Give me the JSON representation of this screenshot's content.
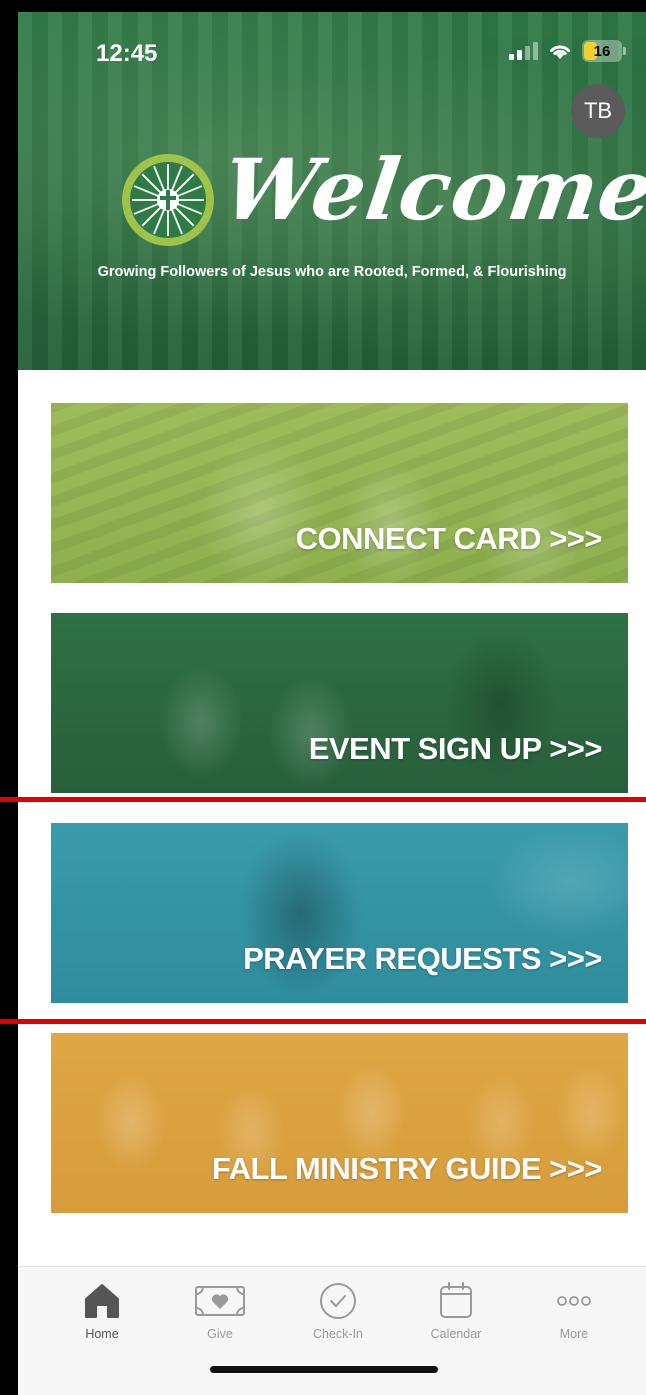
{
  "status_bar": {
    "time": "12:45",
    "battery": "16"
  },
  "hero": {
    "avatar_initials": "TB",
    "title": "Welcome",
    "tagline": "Growing Followers of Jesus who are Rooted, Formed, & Flourishing"
  },
  "cards": [
    {
      "label": "CONNECT CARD >>>"
    },
    {
      "label": "EVENT SIGN UP >>>"
    },
    {
      "label": "PRAYER REQUESTS >>>"
    },
    {
      "label": "FALL MINISTRY GUIDE >>>"
    }
  ],
  "tabs": [
    {
      "label": "Home",
      "icon": "home-icon"
    },
    {
      "label": "Give",
      "icon": "give-icon"
    },
    {
      "label": "Check-In",
      "icon": "check-in-icon"
    },
    {
      "label": "Calendar",
      "icon": "calendar-icon"
    },
    {
      "label": "More",
      "icon": "more-icon"
    }
  ],
  "colors": {
    "brand_green": "#2a6d40",
    "accent_yellow": "#f3cf2f",
    "highlight_red": "#e00000"
  }
}
